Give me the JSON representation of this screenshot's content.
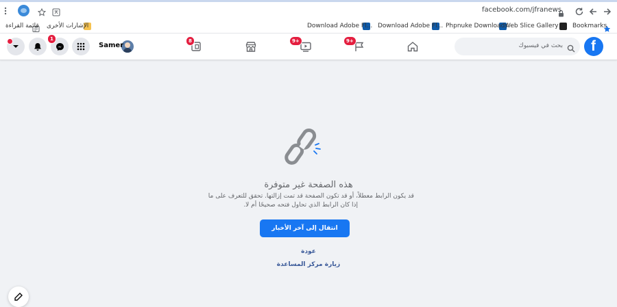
{
  "browser": {
    "url": "facebook.com/jfranews",
    "bookmarks": [
      {
        "label": "Bookmarks",
        "icon": "star-icon"
      },
      {
        "label": "Web Slice Gallery",
        "icon": "web-slice-icon"
      },
      {
        "label": "Phpnuke Downloads",
        "icon": "site-icon"
      },
      {
        "label": "Download Adobe Fl...",
        "icon": "site-icon"
      },
      {
        "label": "Download Adobe Fl...",
        "icon": "site-icon"
      },
      {
        "label": "الإشارات الأخرى",
        "icon": "folder-icon"
      },
      {
        "label": "قائمة القراءة",
        "icon": "reading-list-icon"
      }
    ]
  },
  "fb": {
    "search_placeholder": "بحث في فيسبوك",
    "user_name": "Samer",
    "badges": {
      "flag": "9+",
      "watch": "9+",
      "gaming": "8",
      "messenger": "1"
    }
  },
  "error_page": {
    "title": "هذه الصفحة غير متوفرة",
    "line1": "قد يكون الرابط معطلاً، أو قد تكون الصفحة قد تمت إزالتها. تحقق للتعرف على ما",
    "line2": "إذا كان الرابط الذي تحاول فتحه صحيحًا أم لا.",
    "primary_button": "انتقال إلى آخر الأخبار",
    "back_link": "عودة",
    "help_link": "زيارة مركز المساعدة"
  },
  "colors": {
    "fb_blue": "#1877f2",
    "link": "#385898",
    "badge_red": "#e41e3f",
    "page_bg": "#f0f2f5"
  }
}
